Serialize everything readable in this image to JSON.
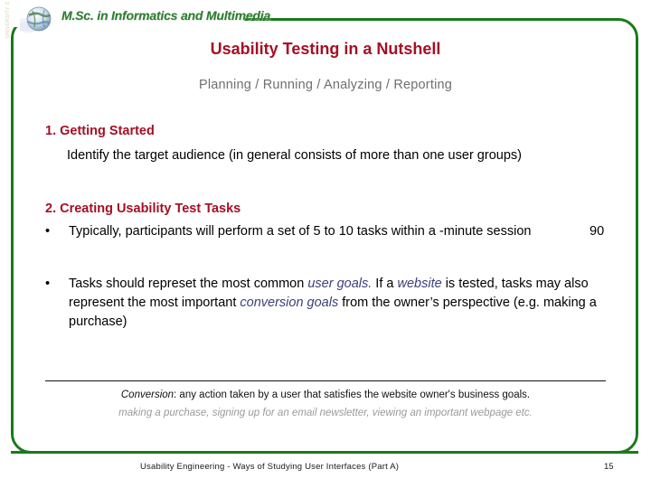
{
  "header": {
    "side_strip_text": "UNIVERSITY OF THE AEGEAN",
    "logo_icon": "globe-logo-icon",
    "program_title": "M.Sc. in Informatics and Multimedia",
    "rule_color": "#1a7a1a"
  },
  "slide": {
    "title": "Usability Testing in a Nutshell",
    "subtitle": "Planning  /  Running / Analyzing / Reporting",
    "title_color": "#a50f23",
    "subtitle_color": "#6f6f6f",
    "frame_color": "#1a7a1a",
    "emphasis_color": "#3b3f7a"
  },
  "sections": [
    {
      "heading": "1. Getting Started",
      "body": "Identify the target audience (in general consists of more than one user groups)"
    },
    {
      "heading": "2. Creating Usability Test Tasks"
    }
  ],
  "bullets": [
    {
      "marker": "•",
      "text_before": "Typically, participants will perform a set of 5 to 10 tasks within a -minute session",
      "trailing_number": "90"
    },
    {
      "marker": "•",
      "part_1": "Tasks should represet the most common ",
      "emph_1": "user goals.",
      "part_2": "  If a ",
      "emph_2": "website",
      "part_3": " is tested, tasks may also represent the most important ",
      "emph_3": "conversion goals",
      "part_4": "  from the owner’s perspective (e.g. making a purchase)"
    }
  ],
  "footnote": {
    "term": "Conversion",
    "definition": ": any action taken by a user that satisfies the website owner's business goals.",
    "examples": "making a purchase, signing up for an email newsletter, viewing an important webpage etc."
  },
  "footer": {
    "text": "Usability Engineering  -  Ways of Studying User Interfaces (Part A)",
    "page_number": "15"
  }
}
